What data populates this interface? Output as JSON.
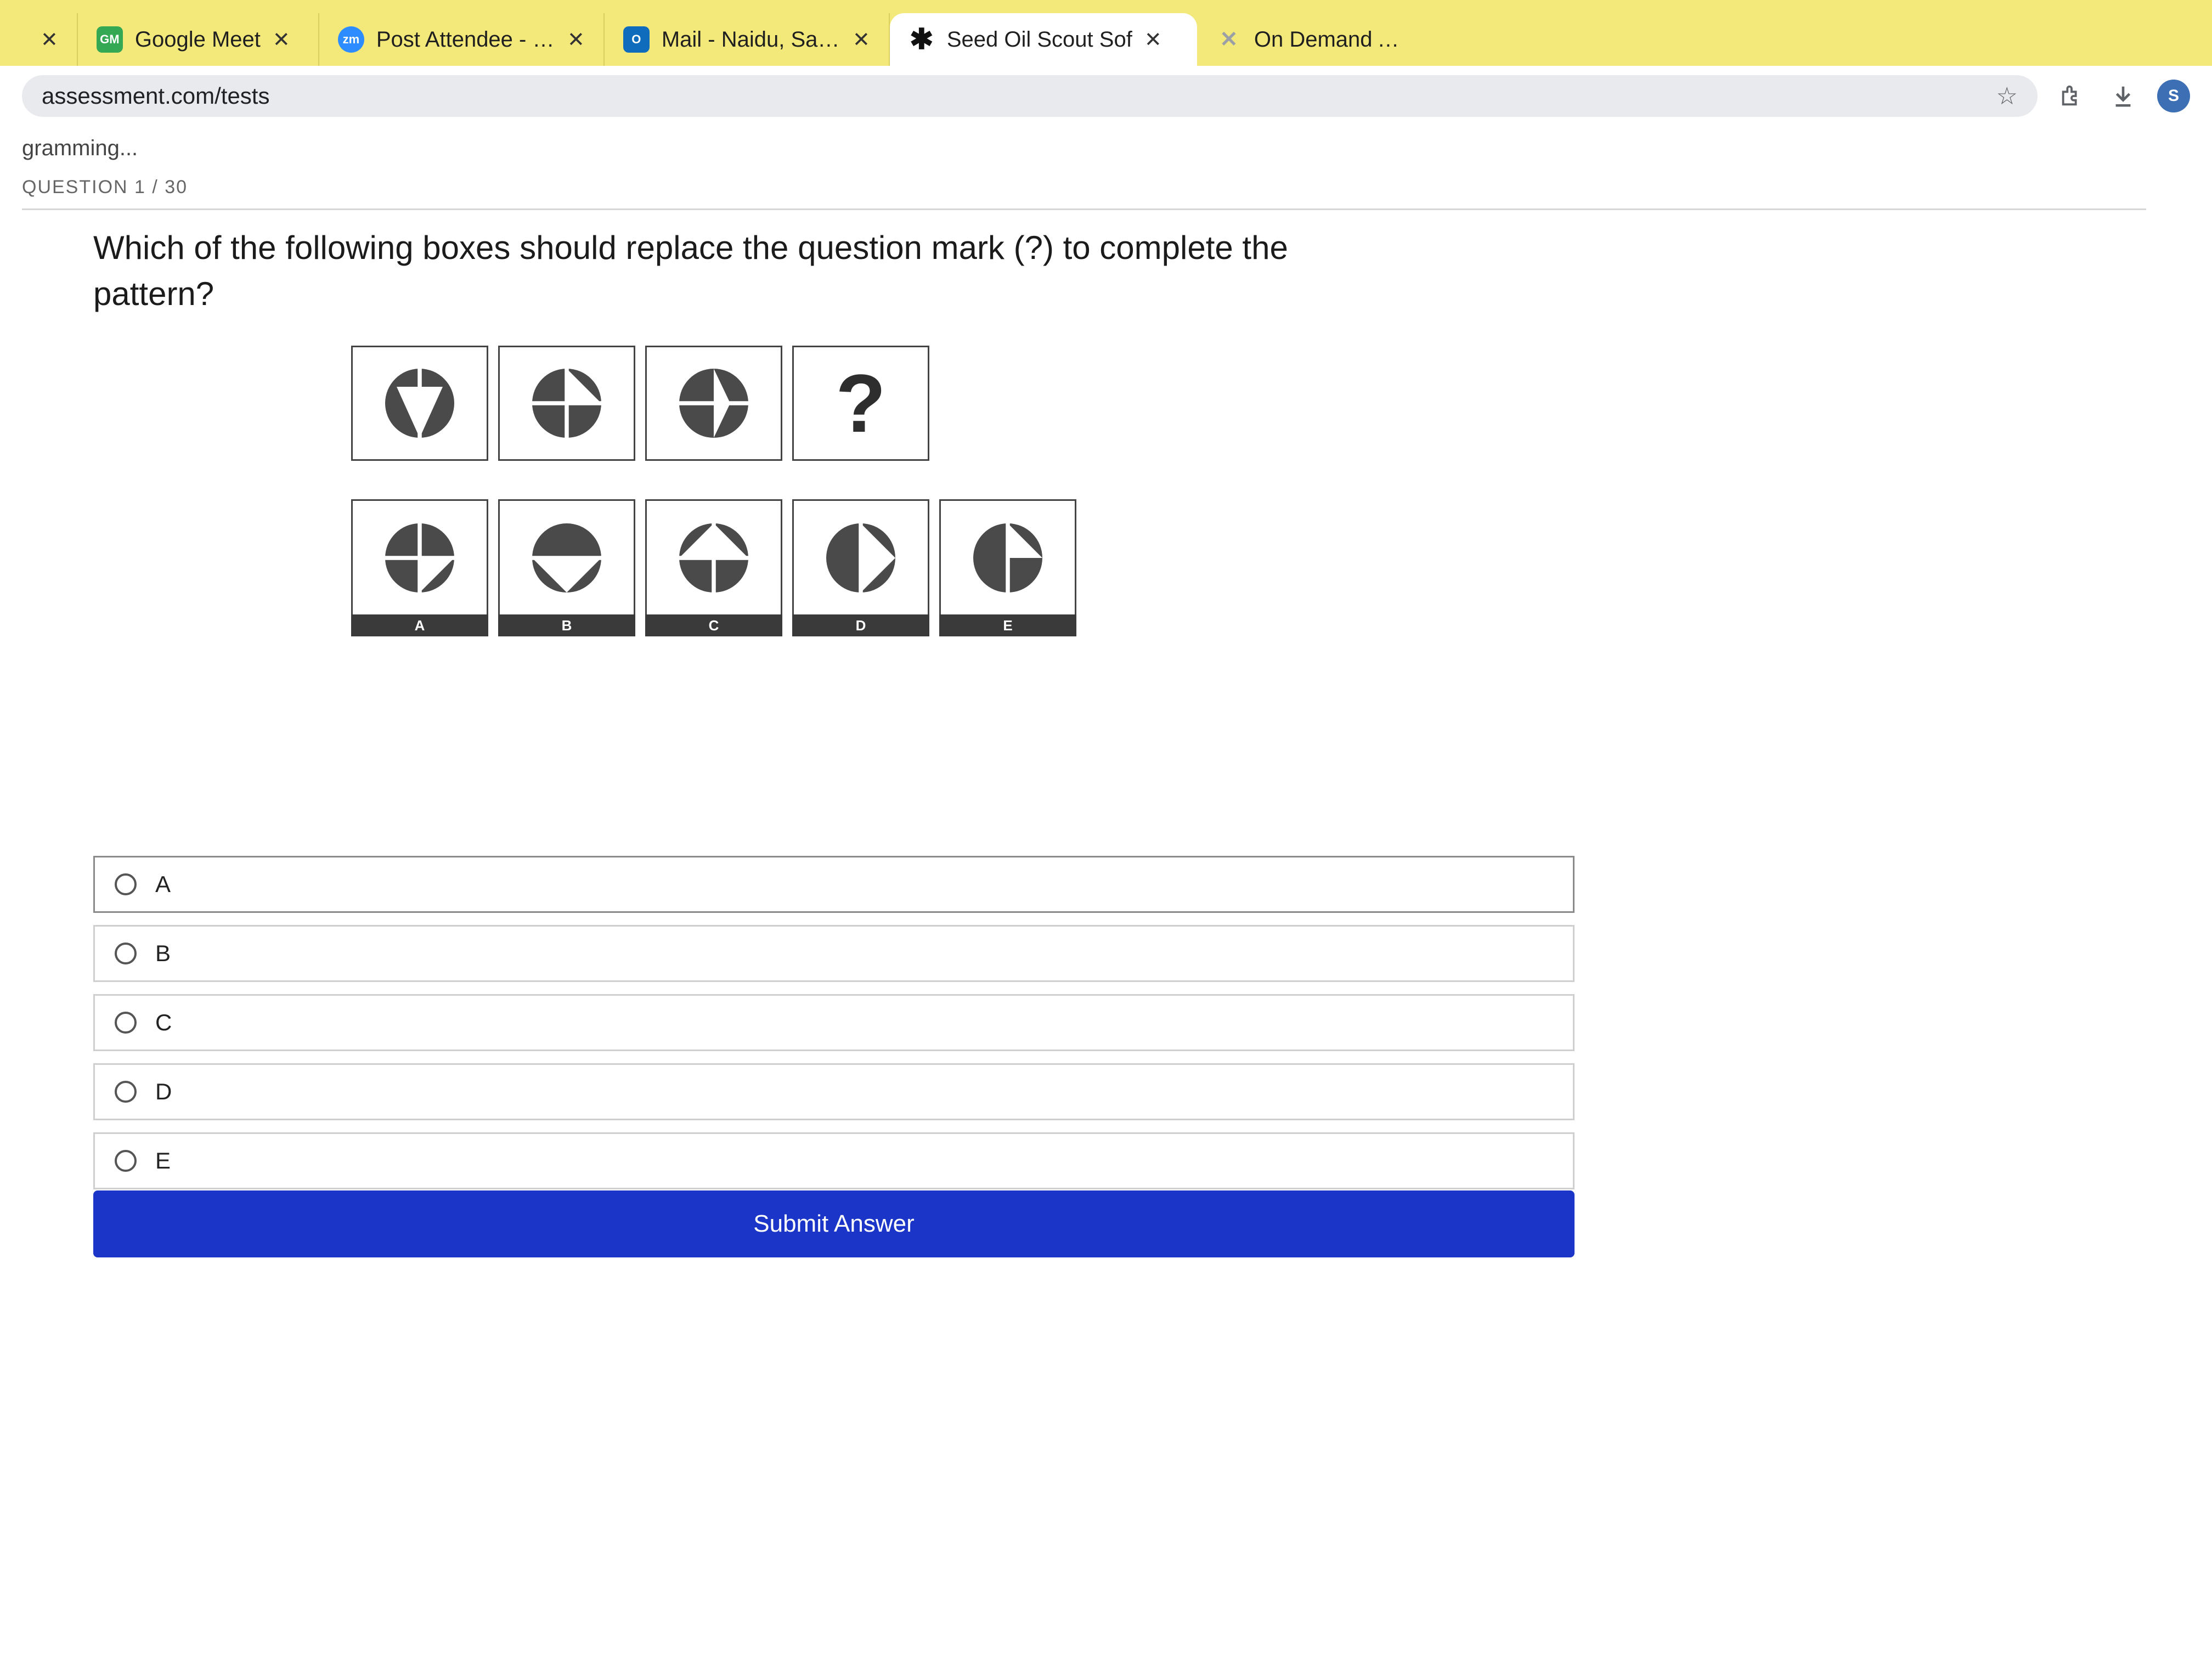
{
  "tabs": [
    {
      "label": "",
      "favicon": "",
      "close": "✕",
      "active": false
    },
    {
      "label": "Google Meet",
      "favicon": "GM",
      "favicon_color": "#34a853",
      "close": "✕",
      "active": false
    },
    {
      "label": "Post Attendee - Zo",
      "favicon": "zm",
      "favicon_color": "#2d8cff",
      "close": "✕",
      "active": false
    },
    {
      "label": "Mail - Naidu, Sanja",
      "favicon": "O",
      "favicon_color": "#0f6cbd",
      "close": "✕",
      "active": false
    },
    {
      "label": "Seed Oil Scout Sof",
      "favicon": "✱",
      "favicon_color": "#111111",
      "close": "✕",
      "active": true
    },
    {
      "label": "On Demand Ass",
      "favicon": "✕",
      "favicon_color": "#9aa0a6",
      "close": "",
      "active": false
    }
  ],
  "toolbar": {
    "url": "assessment.com/tests",
    "bookmark_icon": "star-icon",
    "extension_icon": "puzzle-icon",
    "download_icon": "download-icon",
    "profile_initial": "S"
  },
  "page": {
    "breadcrumb": "gramming...",
    "question_number": "QUESTION 1 / 30",
    "question": "Which of the following boxes should replace the question mark (?) to complete the pattern?",
    "question_mark": "?",
    "answer_labels": [
      "A",
      "B",
      "C",
      "D",
      "E"
    ],
    "options": [
      "A",
      "B",
      "C",
      "D",
      "E"
    ],
    "submit_label": "Submit Answer"
  },
  "colors": {
    "tabbar": "#f3e97a",
    "submit": "#1a35c7",
    "shape_fill": "#4a4a4a"
  }
}
